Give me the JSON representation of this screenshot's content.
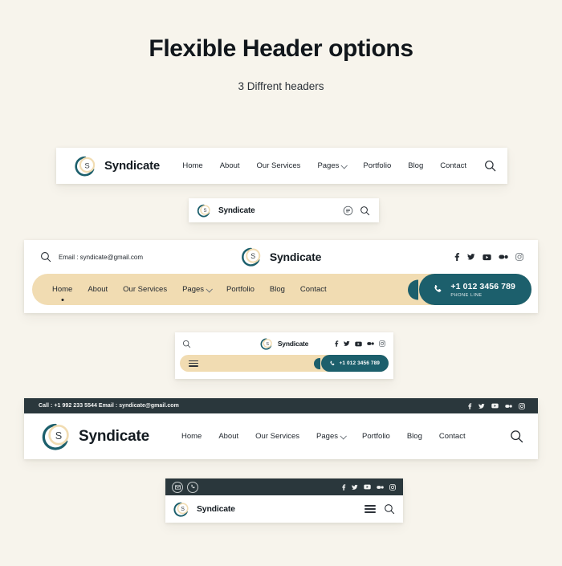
{
  "page": {
    "title": "Flexible Header options",
    "subtitle": "3 Diffrent headers",
    "background_color": "#f7f4ec"
  },
  "brand": {
    "name": "Syndicate",
    "monogram": "S",
    "teal": "#1c5f6c",
    "cream": "#f1dcb2",
    "dark": "#2a373c"
  },
  "nav_items": [
    {
      "label": "Home",
      "has_dropdown": false,
      "active": true
    },
    {
      "label": "About",
      "has_dropdown": false,
      "active": false
    },
    {
      "label": "Our Services",
      "has_dropdown": false,
      "active": false
    },
    {
      "label": "Pages",
      "has_dropdown": true,
      "active": false
    },
    {
      "label": "Portfolio",
      "has_dropdown": false,
      "active": false
    },
    {
      "label": "Blog",
      "has_dropdown": false,
      "active": false
    },
    {
      "label": "Contact",
      "has_dropdown": false,
      "active": false
    }
  ],
  "socials": [
    {
      "name": "facebook-icon"
    },
    {
      "name": "twitter-icon"
    },
    {
      "name": "youtube-icon"
    },
    {
      "name": "vimeo-icon"
    },
    {
      "name": "instagram-icon"
    }
  ],
  "header_one": {
    "nav": [
      "Home",
      "About",
      "Our Services",
      "Pages",
      "Portfolio",
      "Blog",
      "Contact"
    ],
    "search_icon": "search-icon",
    "mobile": {
      "menu_icon": "menu-circle-icon",
      "search_icon": "search-icon"
    }
  },
  "header_two": {
    "email_label": "Email : syndicate@gmail.com",
    "search_icon": "search-icon",
    "nav": [
      "Home",
      "About",
      "Our Services",
      "Pages",
      "Portfolio",
      "Blog",
      "Contact"
    ],
    "phone": {
      "number": "+1 012 3456 789",
      "label": "PHONE LINE",
      "icon": "phone-icon"
    },
    "mobile": {
      "search_icon": "search-icon",
      "menu_icon": "hamburger-icon",
      "phone_number": "+1 012 3456 789"
    }
  },
  "header_three": {
    "topbar_text": "Call : +1 992 233 5544   Email : syndicate@gmail.com",
    "nav": [
      "Home",
      "About",
      "Our Services",
      "Pages",
      "Portfolio",
      "Blog",
      "Contact"
    ],
    "search_icon": "search-icon",
    "mobile": {
      "mail_icon": "envelope-icon",
      "phone_icon": "phone-icon",
      "menu_icon": "hamburger-icon",
      "search_icon": "search-icon"
    }
  }
}
